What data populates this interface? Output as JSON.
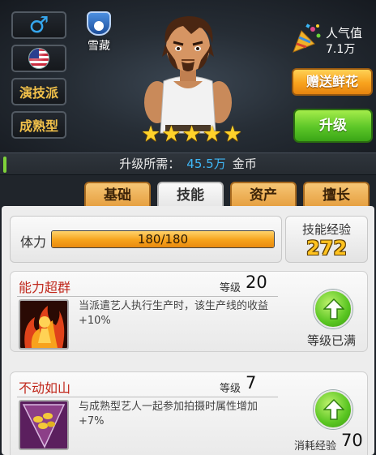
{
  "profile": {
    "gender_icon": "male-icon",
    "nationality_icon": "us-flag-icon",
    "tags": [
      "演技派",
      "成熟型"
    ],
    "name": "雪藏",
    "stars": 5
  },
  "popularity": {
    "label": "人气值",
    "value": "7.1万"
  },
  "buttons": {
    "gift": "赠送鲜花",
    "upgrade": "升级"
  },
  "upgrade_cost": {
    "label": "升级所需：",
    "value": "45.5万",
    "unit": "金币"
  },
  "tabs": [
    {
      "label": "基础"
    },
    {
      "label": "技能"
    },
    {
      "label": "资产"
    },
    {
      "label": "擅长"
    }
  ],
  "active_tab": "技能",
  "stamina": {
    "label": "体力",
    "text": "180/180",
    "fraction": 1.0
  },
  "skill_exp": {
    "label": "技能经验",
    "value": "272"
  },
  "skills": [
    {
      "name": "能力超群",
      "level_label": "等级",
      "level": "20",
      "description": "当派遣艺人执行生产时，该生产线的收益+10%",
      "status": "等级已满",
      "icon": "fire-figure-icon"
    },
    {
      "name": "不动如山",
      "level_label": "等级",
      "level": "7",
      "description": "与成熟型艺人一起参加拍摄时属性增加+7%",
      "cost_label": "消耗经验",
      "cost": "70",
      "icon": "drink-glass-icon"
    }
  ],
  "colors": {
    "accent_orange": "#f8a21d",
    "accent_green": "#5cc628",
    "cost_blue": "#3fb6f5",
    "skill_name_red": "#c0271b",
    "exp_gold": "#ffc21f"
  }
}
